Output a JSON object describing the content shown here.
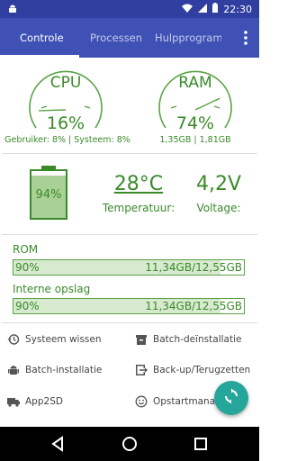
{
  "status_bar": {
    "notification_icon": "android-icon",
    "time": "22:30",
    "icons": [
      "wifi-icon",
      "signal-icon",
      "battery-icon"
    ]
  },
  "tabs": [
    {
      "label": "Controle",
      "active": true
    },
    {
      "label": "Processen",
      "active": false
    },
    {
      "label": "Hulpprogramm",
      "active": false
    }
  ],
  "cpu": {
    "title": "CPU",
    "percent": "16%",
    "value": 16,
    "detail": "Gebruiker: 8% | Systeem: 8%"
  },
  "ram": {
    "title": "RAM",
    "percent": "74%",
    "value": 74,
    "detail": "1,35GB | 1,81GB"
  },
  "battery": {
    "percent": "94%",
    "level": 94,
    "temperature": "28°C",
    "temperature_label": "Temperatuur:",
    "voltage": "4,2V",
    "voltage_label": "Voltage:"
  },
  "storage": [
    {
      "label": "ROM",
      "percent": "90%",
      "fill": 90,
      "value": "11,34GB/12,55GB"
    },
    {
      "label": "Interne opslag",
      "percent": "90%",
      "fill": 90,
      "value": "11,34GB/12,55GB"
    }
  ],
  "actions": [
    {
      "label": "Systeem wissen",
      "icon": "history-icon"
    },
    {
      "label": "Batch-deïnstallatie",
      "icon": "archive-icon"
    },
    {
      "label": "Batch-installatie",
      "icon": "android-icon"
    },
    {
      "label": "Back-up/Terugzetten",
      "icon": "exit-icon"
    },
    {
      "label": "App2SD",
      "icon": "truck-icon"
    },
    {
      "label": "Opstartmanag",
      "icon": "smiley-icon"
    }
  ],
  "colors": {
    "primary": "#3f51b5",
    "status_bar": "#303f9f",
    "accent_green": "#3a8a2a",
    "fab": "#26a69a"
  }
}
